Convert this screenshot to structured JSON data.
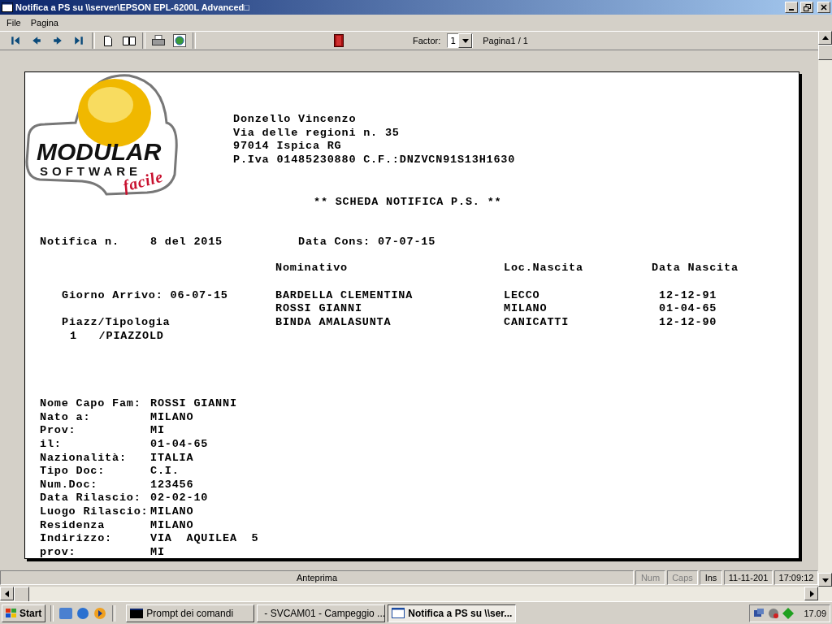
{
  "window": {
    "title": "Notifica a PS su \\\\server\\EPSON EPL-6200L Advanced□"
  },
  "menu": [
    {
      "label": "File"
    },
    {
      "label": "Pagina"
    }
  ],
  "toolbar": {
    "factor_label": "Factor:",
    "factor_value": "1",
    "page_label": "Pagina1 / 1"
  },
  "document": {
    "logo": {
      "line1": "MODULAR",
      "line2": "SOFTWARE",
      "line3": "facile"
    },
    "header_lines": [
      "Donzello Vincenzo",
      "Via delle regioni n. 35",
      "97014 Ispica RG",
      "P.Iva 01485230880 C.F.:DNZVCN91S13H1630"
    ],
    "title": "** SCHEDA NOTIFICA P.S. **",
    "notice": {
      "label": "Notifica n.",
      "value": "8 del 2015",
      "delivery": "Data Cons: 07-07-15"
    },
    "columns": [
      "Nominativo",
      "Loc.Nascita",
      "Data Nascita"
    ],
    "arrival": "Giorno Arrivo: 06-07-15",
    "pitch_label": "Piazz/Tipologia",
    "pitch_value": "1   /PIAZZOLD",
    "guests": [
      {
        "name": "BARDELLA CLEMENTINA",
        "birthplace": "LECCO",
        "birthdate": "12-12-91"
      },
      {
        "name": "ROSSI GIANNI",
        "birthplace": "MILANO",
        "birthdate": "01-04-65"
      },
      {
        "name": "BINDA AMALASUNTA",
        "birthplace": "CANICATTI",
        "birthdate": "12-12-90"
      }
    ],
    "fields": [
      {
        "label": "Nome Capo Fam:",
        "value": "ROSSI GIANNI"
      },
      {
        "label": "Nato a:",
        "value": "MILANO"
      },
      {
        "label": "Prov:",
        "value": "MI"
      },
      {
        "label": "il:",
        "value": "01-04-65"
      },
      {
        "label": "Nazionalità:",
        "value": "ITALIA"
      },
      {
        "label": "Tipo Doc:",
        "value": "C.I."
      },
      {
        "label": "Num.Doc:",
        "value": "123456"
      },
      {
        "label": "Data Rilascio:",
        "value": "02-02-10"
      },
      {
        "label": "Luogo Rilascio:",
        "value": "MILANO"
      },
      {
        "label": "Residenza",
        "value": "MILANO"
      },
      {
        "label": "Indirizzo:",
        "value": "VIA  AQUILEA  5"
      },
      {
        "label": "prov:",
        "value": "MI"
      }
    ]
  },
  "status_bar": {
    "message": "Anteprima",
    "indicators": [
      {
        "label": "Num",
        "disabled": true
      },
      {
        "label": "Caps",
        "disabled": true
      },
      {
        "label": "Ins",
        "disabled": false
      },
      {
        "label": "11-11-201",
        "disabled": false
      },
      {
        "label": "17:09:12",
        "disabled": false
      }
    ]
  },
  "taskbar": {
    "start": "Start",
    "tasks": [
      {
        "label": "Prompt dei comandi",
        "kind": "console",
        "selected": false
      },
      {
        "label": "- SVCAM01 - Campeggio ...",
        "kind": "window",
        "selected": false
      },
      {
        "label": "Notifica a PS su \\\\ser...",
        "kind": "window",
        "selected": true
      }
    ],
    "clock": "17.09"
  }
}
